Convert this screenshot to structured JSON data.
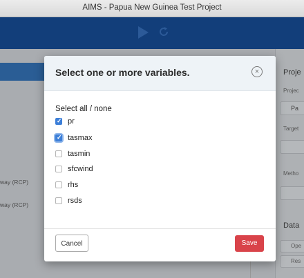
{
  "window": {
    "title": "AIMS - Papua New Guinea Test Project"
  },
  "background": {
    "left_labels": [
      "way (RCP)",
      "way (RCP)"
    ],
    "right_panel": {
      "heading": "Proje",
      "project_label": "Projec",
      "project_value": "Pa",
      "target_label": "Target",
      "method_label": "Metho",
      "data_heading": "Data",
      "open_button": "Ope",
      "reset_button": "Res"
    }
  },
  "modal": {
    "title": "Select one or more variables.",
    "select_all_label": "Select all / none",
    "variables": [
      {
        "label": "pr",
        "checked": true
      },
      {
        "label": "tasmax",
        "checked": true
      },
      {
        "label": "tasmin",
        "checked": false
      },
      {
        "label": "sfcwind",
        "checked": false
      },
      {
        "label": "rhs",
        "checked": false
      },
      {
        "label": "rsds",
        "checked": false
      }
    ],
    "cancel_label": "Cancel",
    "save_label": "Save"
  },
  "colors": {
    "toolbar": "#123e7a",
    "save_button": "#d9434a",
    "checkbox_checked": "#3d7fd8",
    "modal_header": "#eef3f7"
  }
}
